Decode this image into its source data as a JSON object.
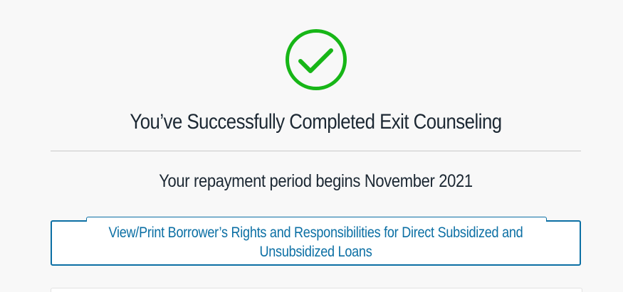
{
  "completion": {
    "icon": "check-circle-icon",
    "icon_color": "#17b617",
    "title": "You’ve Successfully Completed Exit Counseling",
    "repayment_text": "Your repayment period begins November 2021"
  },
  "rights_link": {
    "line1": "View/Print Borrower’s Rights and Responsibilities for Direct Subsidized and",
    "line2": "Unsubsidized Loans",
    "color": "#0b6fa4"
  }
}
